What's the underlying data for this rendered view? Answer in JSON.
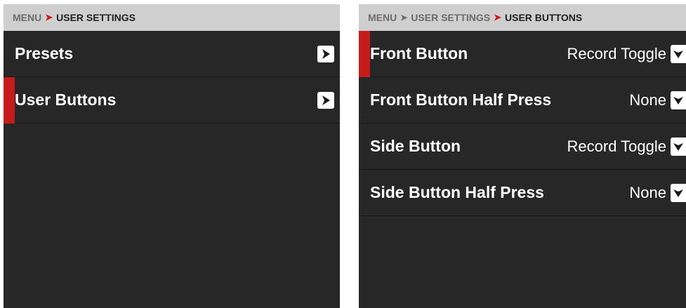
{
  "left": {
    "breadcrumb": {
      "root": "MENU",
      "current": "USER SETTINGS"
    },
    "items": [
      {
        "label": "Presets",
        "selected": false,
        "icon": "chevron-right-icon"
      },
      {
        "label": "User Buttons",
        "selected": true,
        "icon": "chevron-right-icon"
      }
    ]
  },
  "right": {
    "breadcrumb": {
      "root": "MENU",
      "middle": "USER SETTINGS",
      "current": "USER BUTTONS"
    },
    "items": [
      {
        "label": "Front Button",
        "value": "Record Toggle",
        "selected": true,
        "icon": "chevron-down-icon"
      },
      {
        "label": "Front Button Half Press",
        "value": "None",
        "selected": false,
        "icon": "chevron-down-icon"
      },
      {
        "label": "Side Button",
        "value": "Record Toggle",
        "selected": false,
        "icon": "chevron-down-icon"
      },
      {
        "label": "Side Button Half Press",
        "value": "None",
        "selected": false,
        "icon": "chevron-down-icon"
      }
    ]
  },
  "colors": {
    "accent": "#c71a1a",
    "panel_bg": "#272727",
    "breadcrumb_bg": "#cfcfcf"
  }
}
